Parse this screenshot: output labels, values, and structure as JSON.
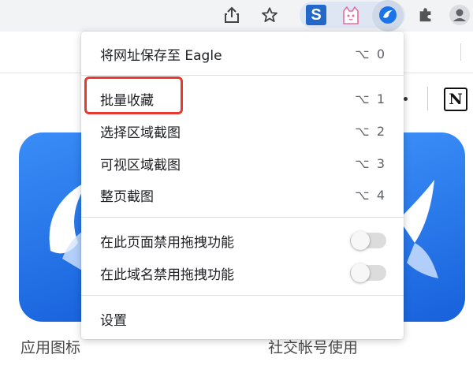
{
  "toolbar": {
    "icons": [
      "share-icon",
      "star-icon",
      "s-extension-icon",
      "cat-extension-icon",
      "eagle-extension-icon",
      "puzzle-icon",
      "profile-icon"
    ],
    "s_ext_letter": "S",
    "colors": {
      "s_ext": "#2368c9",
      "eagle": "#1a73e8",
      "cat": "#e86aa0"
    }
  },
  "menu": {
    "items": [
      {
        "label": "将网址保存至 Eagle",
        "shortcut": "⌥ 0"
      },
      {
        "label": "批量收藏",
        "shortcut": "⌥ 1"
      },
      {
        "label": "选择区域截图",
        "shortcut": "⌥ 2"
      },
      {
        "label": "可视区域截图",
        "shortcut": "⌥ 3"
      },
      {
        "label": "整页截图",
        "shortcut": "⌥ 4"
      }
    ],
    "toggles": [
      {
        "label": "在此页面禁用拖拽功能",
        "on": false
      },
      {
        "label": "在此域名禁用拖拽功能",
        "on": false
      }
    ],
    "settings_label": "设置",
    "highlight_color": "#e53a2f"
  },
  "page": {
    "notion_letter": "N",
    "left_label": "应用图标",
    "right_label": "社交帐号使用"
  }
}
